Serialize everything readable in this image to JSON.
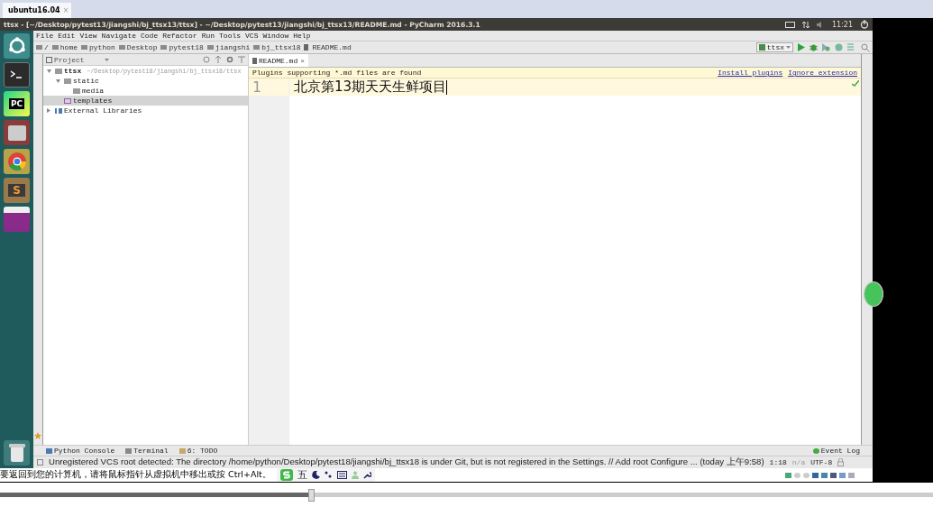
{
  "vm_tab": {
    "label": "ubuntu16.04",
    "close": "×"
  },
  "top_bar": {
    "title": "ttsx - [~/Desktop/pytest13/jiangshi/bj_ttsx13/ttsx] - ~/Desktop/pytest13/jiangshi/bj_ttsx13/README.md - PyCharm 2016.3.1",
    "clock": "11:21"
  },
  "launcher": [
    {
      "kind": "ubuntu"
    },
    {
      "kind": "terminal"
    },
    {
      "kind": "pycharm",
      "label": "PC"
    },
    {
      "kind": "files"
    },
    {
      "kind": "chrome"
    },
    {
      "kind": "sublime",
      "label": "S"
    },
    {
      "kind": "app"
    },
    {
      "kind": "trash"
    }
  ],
  "menu": [
    "File",
    "Edit",
    "View",
    "Navigate",
    "Code",
    "Refactor",
    "Run",
    "Tools",
    "VCS",
    "Window",
    "Help"
  ],
  "breadcrumbs": [
    {
      "label": "/",
      "kind": "folder"
    },
    {
      "label": "home",
      "kind": "folder"
    },
    {
      "label": "python",
      "kind": "folder"
    },
    {
      "label": "Desktop",
      "kind": "folder"
    },
    {
      "label": "pytest18",
      "kind": "folder"
    },
    {
      "label": "jiangshi",
      "kind": "folder"
    },
    {
      "label": "bj_ttsx18",
      "kind": "folder"
    },
    {
      "label": "README.md",
      "kind": "file"
    }
  ],
  "run_config": "ttsx",
  "project_panel": {
    "title": "Project",
    "tree": [
      {
        "label": "ttsx",
        "path": "~/Desktop/pytest18/jiangshi/bj_ttsx18/ttsx",
        "kind": "folder",
        "expanded": true,
        "selected": false,
        "children": [
          {
            "label": "static",
            "kind": "folder",
            "expanded": true,
            "selected": false,
            "children": [
              {
                "label": "media",
                "kind": "folder",
                "selected": false
              }
            ]
          },
          {
            "label": "templates",
            "kind": "template",
            "selected": true
          }
        ]
      },
      {
        "label": "External Libraries",
        "kind": "library",
        "expanded": false,
        "selected": false
      }
    ]
  },
  "editor_tabs": [
    {
      "label": "README.md",
      "close": "×",
      "selected": true
    }
  ],
  "notification": {
    "text": "Plugins supporting *.md files are found",
    "links": [
      "Install plugins",
      "Ignore extension"
    ]
  },
  "lines": [
    {
      "number": "1",
      "text": "北京第13期天天生鲜项目",
      "current": true
    }
  ],
  "tool_windows": [
    {
      "label": "Python Console",
      "kind": "python"
    },
    {
      "label": "Terminal",
      "kind": "terminal"
    },
    {
      "label": "6: TODO",
      "kind": "todo"
    }
  ],
  "event_log": "Event Log",
  "status_bar": {
    "message": "Unregistered VCS root detected: The directory /home/python/Desktop/pytest18/jiangshi/bj_ttsx18 is under Git, but is not registered in the Settings. // Add root  Configure ... (today 上午9:58)",
    "position": "1:18",
    "separator": "n/a",
    "encoding": "UTF-8"
  },
  "vm_hint": "要返回到您的计算机，请将鼠标指针从虚拟机中移出或按 Ctrl+Alt。",
  "ime_toolbar": {
    "mode": "五"
  },
  "timeline": {
    "level": 0.33
  }
}
